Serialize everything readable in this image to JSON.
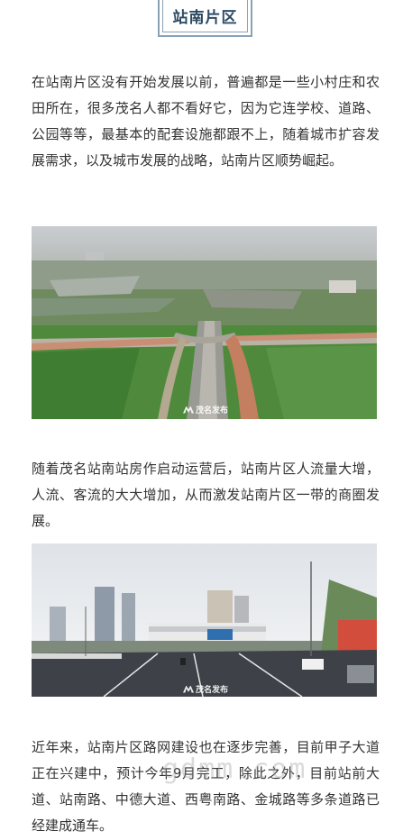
{
  "section": {
    "title": "站南片区"
  },
  "paragraphs": [
    "在站南片区没有开始发展以前，普遍都是一些小村庄和农田所在，很多茂名人都不看好它，因为它连学校、道路、公园等等，最基本的配套设施都跟不上，随着城市扩容发展需求，以及城市发展的战略，站南片区顺势崛起。",
    "随着茂名站南站房作启动运营后，站南片区人流量大增，人流、客流的大大增加，从而激发站南片区一带的商圈发展。",
    "近年来，站南片区路网建设也在逐步完善，目前甲子大道正在兴建中，预计今年9月完工，除此之外，目前站前大道、站南路、中德大道、西粤南路、金城路等多条道路已经建成通车。"
  ],
  "photos": {
    "aerial": {
      "logo_text": "茂名发布"
    },
    "station": {
      "logo_text": "茂名发布"
    }
  },
  "watermark": "gdmm.com"
}
